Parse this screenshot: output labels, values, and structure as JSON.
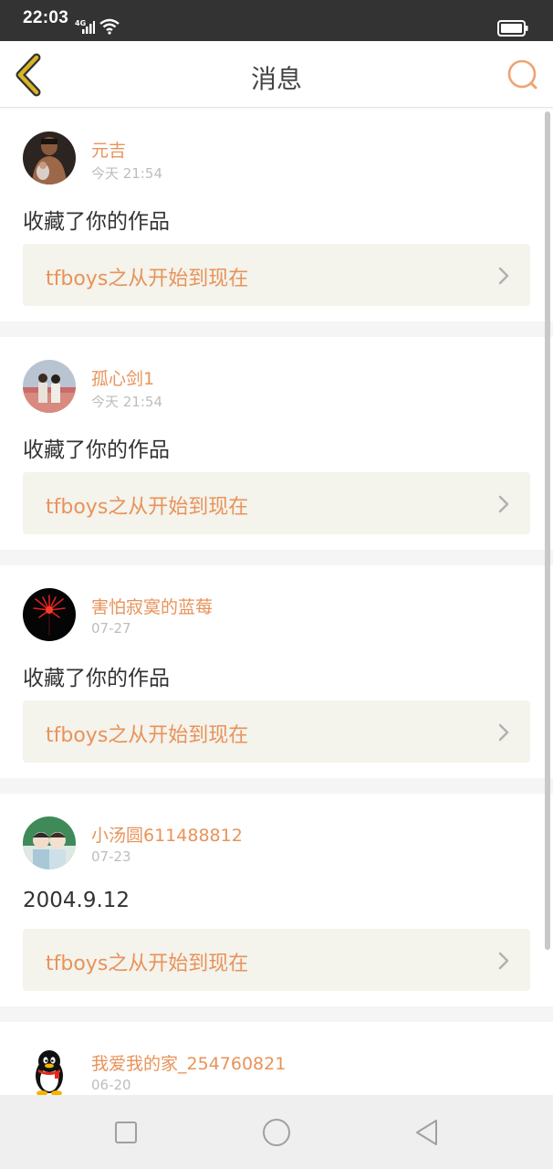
{
  "status_bar": {
    "time": "22:03",
    "network": "4G"
  },
  "header": {
    "title": "消息"
  },
  "colors": {
    "accent": "#e8935a",
    "back_icon": "#d9b526",
    "card_link_bg": "#f4f3ec"
  },
  "messages": [
    {
      "username": "元吉",
      "time": "今天 21:54",
      "text": "收藏了你的作品",
      "work_title": "tfboys之从开始到现在",
      "avatar": "person-photo"
    },
    {
      "username": "孤心剑1",
      "time": "今天 21:54",
      "text": "收藏了你的作品",
      "work_title": "tfboys之从开始到现在",
      "avatar": "couple-photo"
    },
    {
      "username": "害怕寂寞的蓝莓",
      "time": "07-27",
      "text": "收藏了你的作品",
      "work_title": "tfboys之从开始到现在",
      "avatar": "red-flower-photo"
    },
    {
      "username": "小汤圆611488812",
      "time": "07-23",
      "text": "2004.9.12",
      "work_title": "tfboys之从开始到现在",
      "avatar": "two-boys-photo"
    },
    {
      "username": "我爱我的家_254760821",
      "time": "06-20",
      "avatar": "qq-penguin"
    }
  ],
  "system_nav": {
    "icons": [
      "recent-apps-icon",
      "home-icon",
      "back-triangle-icon"
    ]
  }
}
